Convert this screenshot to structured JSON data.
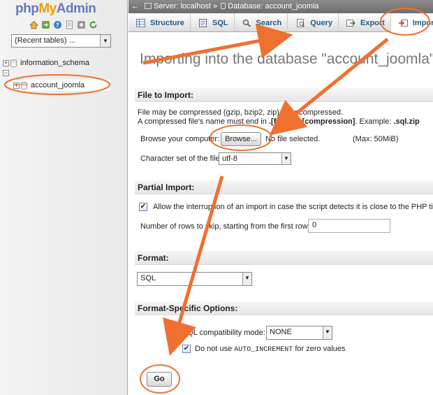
{
  "logo": {
    "php": "php",
    "my": "My",
    "admin": "Admin"
  },
  "sidebar": {
    "recent_tables": "(Recent tables) ...",
    "databases": [
      {
        "name": "information_schema"
      },
      {
        "name": "account_joomla"
      }
    ]
  },
  "breadcrumb": {
    "back": "←",
    "server": "Server: localhost",
    "separator": "»",
    "database": "Database: account_joomla"
  },
  "tabs": [
    {
      "label": "Structure",
      "icon": "structure-icon"
    },
    {
      "label": "SQL",
      "icon": "sql-icon"
    },
    {
      "label": "Search",
      "icon": "search-icon"
    },
    {
      "label": "Query",
      "icon": "query-icon"
    },
    {
      "label": "Export",
      "icon": "export-icon"
    },
    {
      "label": "Import",
      "icon": "import-icon",
      "active": true
    }
  ],
  "page_title": "Importing into the database \"account_joomla\"",
  "file_import": {
    "heading": "File to Import:",
    "desc1": "File may be compressed (gzip, bzip2, zip) or uncompressed.",
    "desc2_prefix": "A compressed file's name must end in ",
    "desc2_bold": ".[format].[compression]",
    "desc2_mid": ". Example: ",
    "desc2_example": ".sql.zip",
    "browse_label": "Browse your computer:",
    "browse_button": "Browse...",
    "no_file": "No file selected.",
    "max_size": "(Max: 50MiB)",
    "charset_label": "Character set of the file:",
    "charset_value": "utf-8"
  },
  "partial_import": {
    "heading": "Partial Import:",
    "allow_interrupt_label": "Allow the interruption of an import in case the script detects it is close to the PHP time",
    "allow_interrupt_checked": true,
    "skip_rows_label": "Number of rows to skip, starting from the first row:",
    "skip_rows_value": "0"
  },
  "format": {
    "heading": "Format:",
    "value": "SQL"
  },
  "format_options": {
    "heading": "Format-Specific Options:",
    "compat_label": "SQL compatibility mode:",
    "compat_value": "NONE",
    "auto_inc_prefix": "Do not use ",
    "auto_inc_code": "AUTO_INCREMENT",
    "auto_inc_suffix": " for zero values",
    "auto_inc_checked": true
  },
  "go_button": "Go",
  "colors": {
    "annotation": "#f07030",
    "link": "#235a81",
    "logo_blue": "#6c78b8",
    "logo_orange": "#f29900"
  }
}
